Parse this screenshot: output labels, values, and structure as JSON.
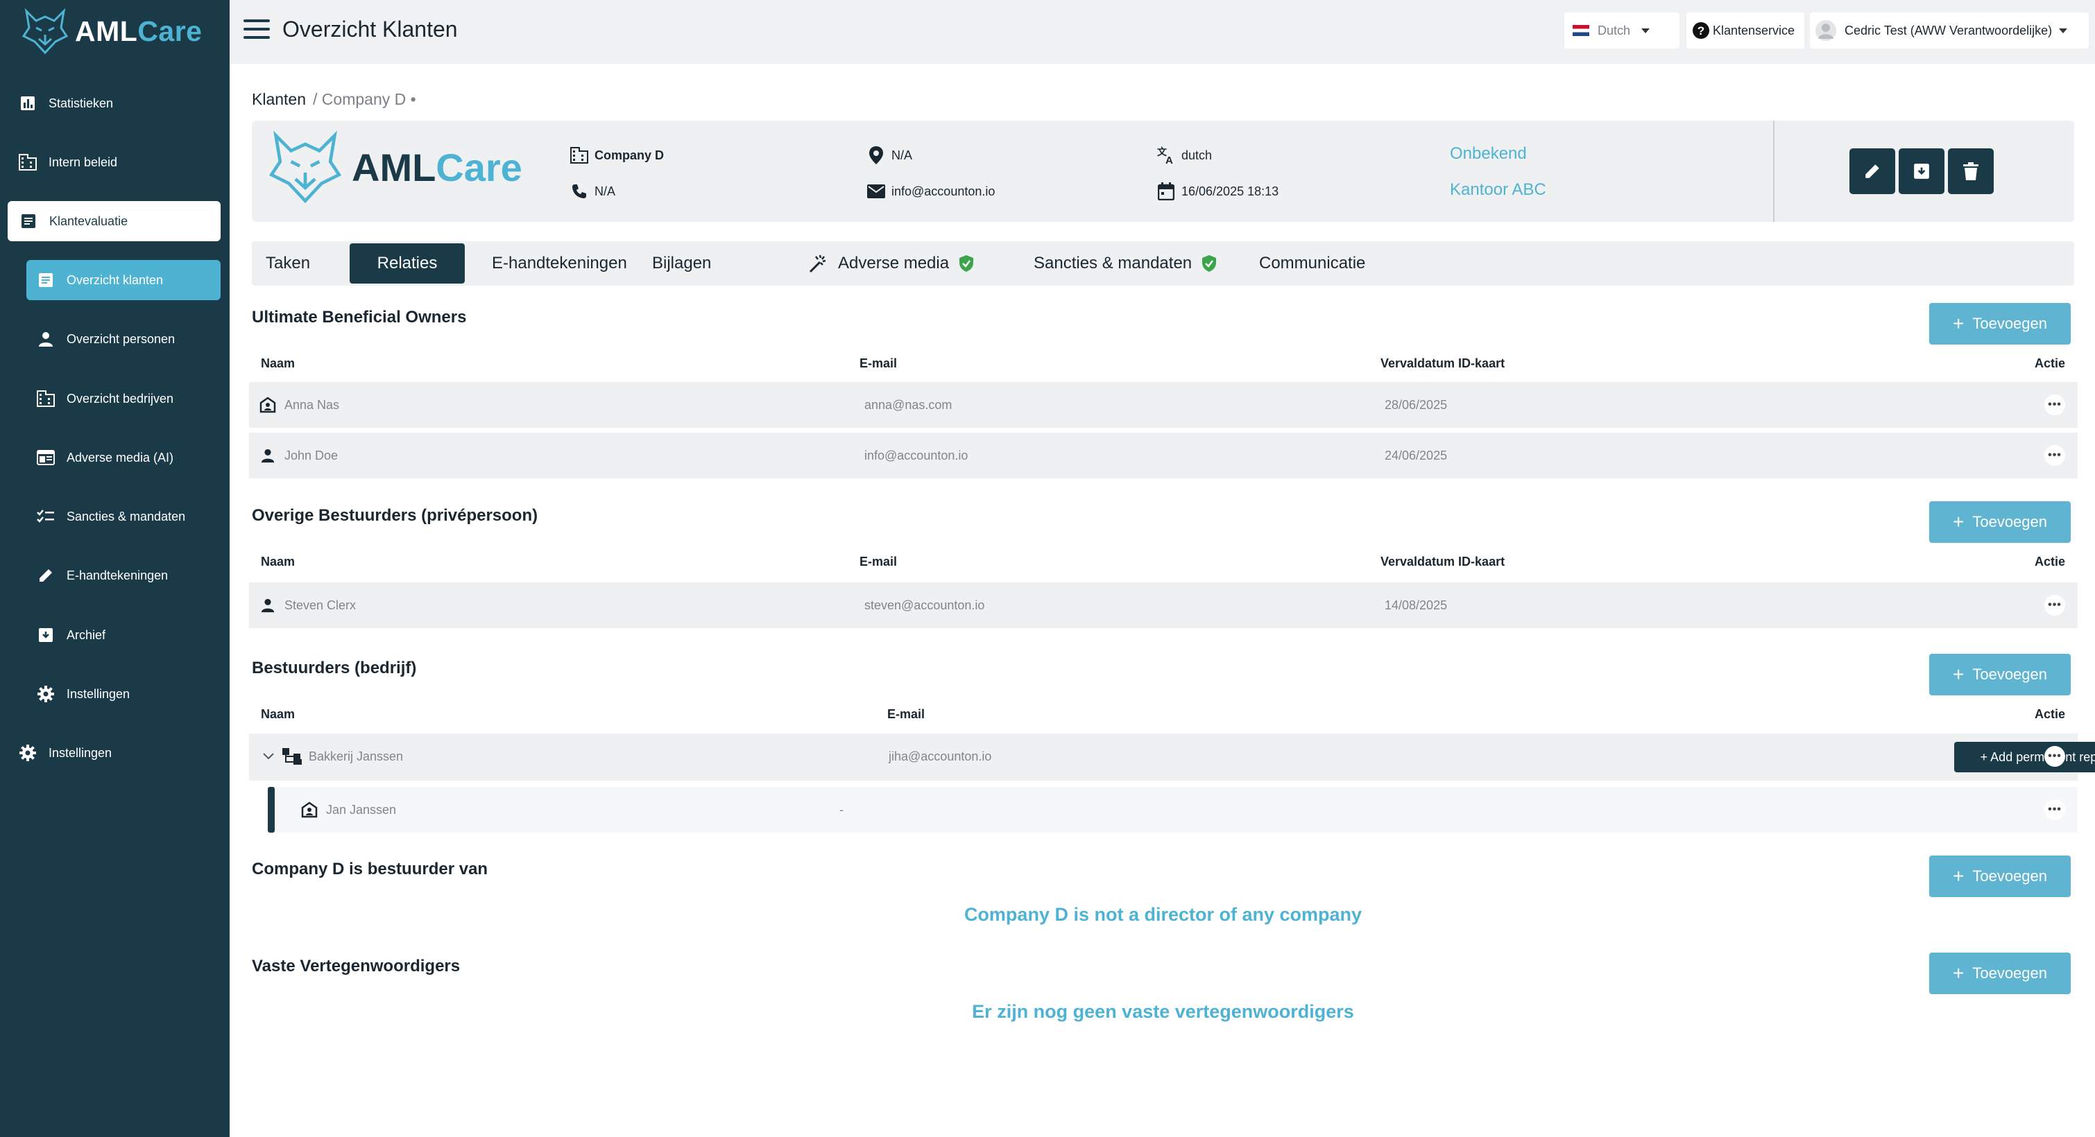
{
  "app": {
    "logo_part1": "AML",
    "logo_part2": "Care"
  },
  "sidebar": {
    "items": [
      {
        "label": "Statistieken",
        "icon": "bar-chart-icon"
      },
      {
        "label": "Intern beleid",
        "icon": "building-icon"
      },
      {
        "label": "Klantevaluatie",
        "icon": "document-icon"
      },
      {
        "label": "Overzicht klanten",
        "icon": "document-icon"
      },
      {
        "label": "Overzicht personen",
        "icon": "person-icon"
      },
      {
        "label": "Overzicht bedrijven",
        "icon": "building-icon"
      },
      {
        "label": "Adverse media (AI)",
        "icon": "newspaper-icon"
      },
      {
        "label": "Sancties & mandaten",
        "icon": "checklist-icon"
      },
      {
        "label": "E-handtekeningen",
        "icon": "pencil-icon"
      },
      {
        "label": "Archief",
        "icon": "archive-icon"
      },
      {
        "label": "Instellingen",
        "icon": "gear-icon"
      },
      {
        "label": "Instellingen",
        "icon": "gear-icon"
      }
    ]
  },
  "header": {
    "title": "Overzicht Klanten",
    "language": "Dutch",
    "support": "Klantenservice",
    "user": "Cedric Test (AWW Verantwoordelijke)"
  },
  "breadcrumb": {
    "root": "Klanten",
    "current": "/ Company D •"
  },
  "company": {
    "name": "Company D",
    "phone": "N/A",
    "location": "N/A",
    "email": "info@accounton.io",
    "language": "dutch",
    "date": "16/06/2025 18:13",
    "status": "Onbekend",
    "office": "Kantoor ABC"
  },
  "tabs": [
    {
      "label": "Taken"
    },
    {
      "label": "Relaties"
    },
    {
      "label": "E-handtekeningen"
    },
    {
      "label": "Bijlagen"
    },
    {
      "label": "Adverse media"
    },
    {
      "label": "Sancties & mandaten"
    },
    {
      "label": "Communicatie"
    }
  ],
  "add_label": "Toevoegen",
  "columns": {
    "name": "Naam",
    "email": "E-mail",
    "expiry": "Vervaldatum ID-kaart",
    "action": "Actie"
  },
  "ubo": {
    "title": "Ultimate Beneficial Owners",
    "rows": [
      {
        "name": "Anna Nas",
        "email": "anna@nas.com",
        "expiry": "28/06/2025"
      },
      {
        "name": "John Doe",
        "email": "info@accounton.io",
        "expiry": "24/06/2025"
      }
    ]
  },
  "other_directors": {
    "title": "Overige Bestuurders (privépersoon)",
    "rows": [
      {
        "name": "Steven Clerx",
        "email": "steven@accounton.io",
        "expiry": "14/08/2025"
      }
    ]
  },
  "company_directors": {
    "title": "Bestuurders (bedrijf)",
    "rows": [
      {
        "name": "Bakkerij Janssen",
        "email": "jiha@accounton.io",
        "button": "+ Add permanent representative"
      }
    ],
    "sub_rows": [
      {
        "name": "Jan Janssen",
        "email": "-"
      }
    ]
  },
  "director_of": {
    "title": "Company D is bestuurder van",
    "empty": "Company D is not a director of any company"
  },
  "permanent_reps": {
    "title": "Vaste Vertegenwoordigers",
    "empty": "Er zijn nog geen vaste vertegenwoordigers"
  },
  "colors": {
    "sidebar": "#1b3a48",
    "accent": "#4eb3d3",
    "button": "#5fb4d1",
    "shield_green": "#3aa54a"
  }
}
